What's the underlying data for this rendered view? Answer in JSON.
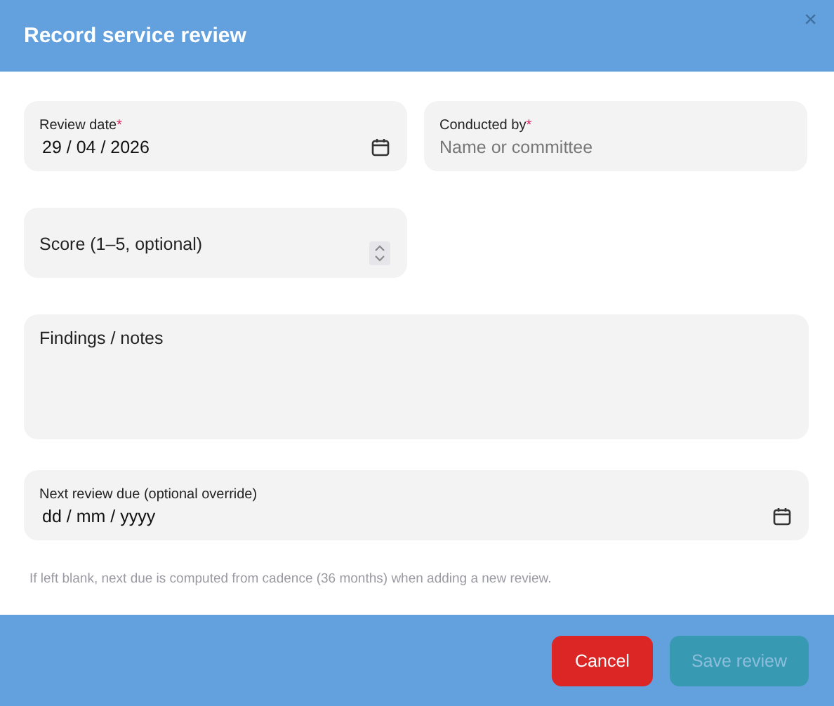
{
  "dialog": {
    "title": "Record service review",
    "close": "×"
  },
  "required_mark": "*",
  "fields": [
    {
      "kind": "date",
      "label": "Review date",
      "required": true,
      "value": "29 / 04 / 2026"
    },
    {
      "kind": "text",
      "label": "Conducted by",
      "required": true,
      "placeholder": "Name or committee"
    },
    {
      "kind": "number",
      "label": "Score (1–5, optional)",
      "required": false
    },
    {
      "kind": "textarea",
      "label": "Findings / notes",
      "required": false
    },
    {
      "kind": "date",
      "label": "Next review due (optional override)",
      "required": false,
      "value": "dd / mm / yyyy"
    }
  ],
  "hint": "If left blank, next due is computed from cadence (36 months) when adding a new review.",
  "buttons": [
    {
      "label": "Cancel",
      "kind": "danger",
      "disabled": false
    },
    {
      "label": "Save review",
      "kind": "primary",
      "disabled": true
    }
  ]
}
